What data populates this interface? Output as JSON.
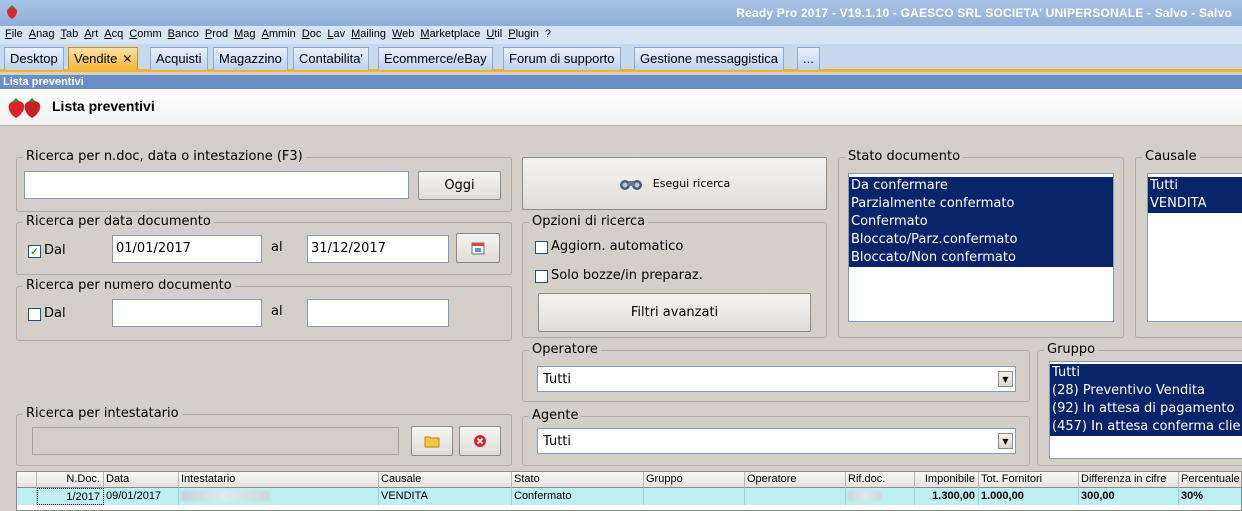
{
  "window": {
    "title": "Ready Pro 2017 - V19.1.10 - GAESCO SRL SOCIETA' UNIPERSONALE - Salvo - Salvo"
  },
  "menu": [
    "File",
    "Anag",
    "Tab",
    "Art",
    "Acq",
    "Comm",
    "Banco",
    "Prod",
    "Mag",
    "Ammin",
    "Doc",
    "Lav",
    "Mailing",
    "Web",
    "Marketplace",
    "Util",
    "Plugin",
    "?"
  ],
  "tabs": [
    {
      "label": "Desktop",
      "active": false
    },
    {
      "label": "Vendite",
      "active": true,
      "close": "✕"
    },
    {
      "label": "Acquisti",
      "active": false
    },
    {
      "label": "Magazzino",
      "active": false
    },
    {
      "label": "Contabilita'",
      "active": false
    },
    {
      "label": "Ecommerce/eBay",
      "active": false
    },
    {
      "label": "Forum di supporto",
      "active": false
    },
    {
      "label": "Gestione messaggistica",
      "active": false
    },
    {
      "label": "...",
      "active": false
    }
  ],
  "subheader": "Lista preventivi",
  "page_title": "Lista preventivi",
  "search_text": {
    "legend": "Ricerca per n.doc, data o intestazione (F3)",
    "value": "",
    "today_button": "Oggi"
  },
  "search_date": {
    "legend": "Ricerca per data documento",
    "from_label": "Dal",
    "from_checked": true,
    "from_value": "01/01/2017",
    "to_label": "al",
    "to_value": "31/12/2017"
  },
  "search_number": {
    "legend": "Ricerca per numero documento",
    "from_label": "Dal",
    "from_checked": false,
    "from_value": "",
    "to_label": "al",
    "to_value": ""
  },
  "search_holder": {
    "legend": "Ricerca per intestatario",
    "value": ""
  },
  "run_search_button": "Esegui ricerca",
  "search_options": {
    "legend": "Opzioni di ricerca",
    "auto_update": "Aggiorn. automatico",
    "auto_update_checked": false,
    "drafts_only": "Solo bozze/in preparaz.",
    "drafts_only_checked": false,
    "advanced_filters": "Filtri avanzati"
  },
  "doc_status": {
    "legend": "Stato documento",
    "items": [
      "Da confermare",
      "Parzialmente confermato",
      "Confermato",
      "Bloccato/Parz.confermato",
      "Bloccato/Non confermato"
    ]
  },
  "reason": {
    "legend": "Causale",
    "items": [
      "Tutti",
      "VENDITA"
    ]
  },
  "operator": {
    "legend": "Operatore",
    "selected": "Tutti"
  },
  "agent": {
    "legend": "Agente",
    "selected": "Tutti"
  },
  "group": {
    "legend": "Gruppo",
    "items": [
      "Tutti",
      "(28) Preventivo Vendita",
      "(92) In attesa di pagamento",
      "(457) In attesa conferma clie"
    ]
  },
  "table": {
    "columns": [
      "",
      "N.Doc.",
      "Data",
      "Intestatario",
      "Causale",
      "Stato",
      "Gruppo",
      "Operatore",
      "Rif.doc.",
      "Imponibile",
      "Tot. Fornitori",
      "Differenza in cifre",
      "Percentuale"
    ],
    "rows": [
      {
        "ndoc": "1/2017",
        "data": "09/01/2017",
        "intestatario": "",
        "causale": "VENDITA",
        "stato": "Confermato",
        "gruppo": "",
        "operatore": "",
        "rifdoc": "",
        "imponibile": "1.300,00",
        "tot_fornitori": "1.000,00",
        "differenza": "300,00",
        "percentuale": "30%"
      }
    ]
  },
  "colors": {
    "selection": "#0a246a",
    "active_tab": "#f3b73c",
    "row_highlight": "#bfeff1"
  }
}
